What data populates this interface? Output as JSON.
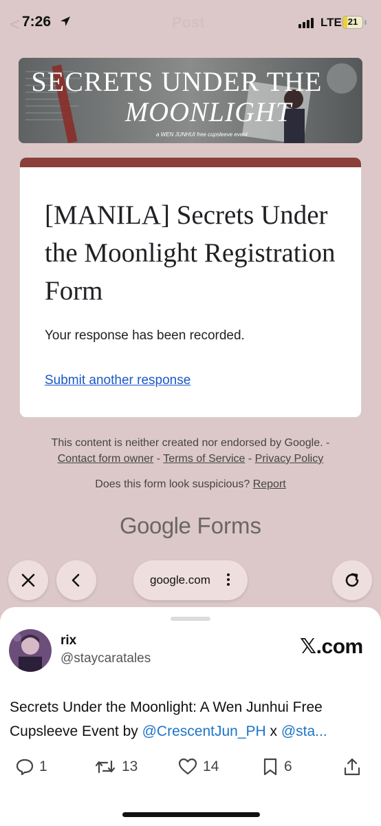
{
  "status_bar": {
    "back_ghost": "<",
    "title_ghost": "Post",
    "time": "7:26",
    "network": "LTE",
    "battery": "21",
    "battery_level": 0.21
  },
  "banner": {
    "title_line1": "SECRETS UNDER THE",
    "title_line2": "MOONLIGHT",
    "caption": "a WEN JUNHUI free cupsleeve event"
  },
  "form": {
    "title": "[MANILA] Secrets Under the Moonlight Registration Form",
    "message": "Your response has been recorded.",
    "submit_another": "Submit another response",
    "accent_color": "#8a3f38"
  },
  "footer": {
    "disclaimer": "This content is neither created nor endorsed by Google. -",
    "contact_link": "Contact form owner",
    "sep1": " - ",
    "terms_link": "Terms of Service",
    "sep2": " - ",
    "privacy_link": "Privacy Policy",
    "suspicious_text": "Does this form look suspicious? ",
    "report_link": "Report",
    "logo_google": "Google",
    "logo_forms": " Forms"
  },
  "browser": {
    "url": "google.com",
    "close_icon": "close-icon",
    "back_icon": "chevron-left-icon",
    "reload_icon": "reload-icon"
  },
  "tweet": {
    "name": "rix",
    "handle": "@staycaratales",
    "brand": "𝕏.com",
    "text_line1": "Secrets Under the Moonlight: A Wen Junhui Free",
    "text_line2_prefix": "Cupsleeve Event by ",
    "mention1": "@CrescentJun_PH",
    "text_mid": " x ",
    "mention2": "@sta...",
    "replies": "1",
    "retweets": "13",
    "likes": "14",
    "bookmarks": "6"
  }
}
